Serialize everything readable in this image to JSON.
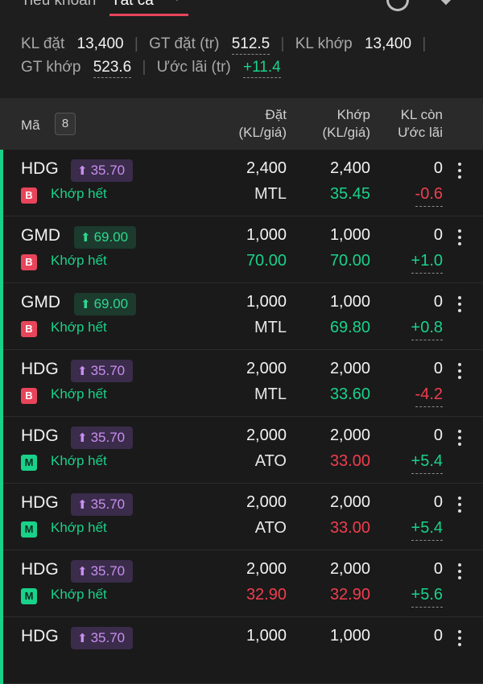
{
  "topbar": {
    "account_label": "Tiểu khoản",
    "filter_value": "Tất cả",
    "icons": [
      "refresh-icon",
      "filter-icon"
    ]
  },
  "summary": {
    "kl_dat_label": "KL đặt",
    "kl_dat": "13,400",
    "gt_dat_label": "GT đặt (tr)",
    "gt_dat": "512.5",
    "kl_khop_label": "KL khớp",
    "kl_khop": "13,400",
    "gt_khop_label": "GT khớp",
    "gt_khop": "523.6",
    "uoc_lai_label": "Ước lãi (tr)",
    "uoc_lai": "+11.4"
  },
  "header": {
    "ma": "Mã",
    "count": "8",
    "dat_l1": "Đặt",
    "dat_l2": "(KL/giá)",
    "khop_l1": "Khớp",
    "khop_l2": "(KL/giá)",
    "klcon_l1": "KL còn",
    "klcon_l2": "Ước lãi"
  },
  "rows": [
    {
      "symbol": "HDG",
      "pill": "35.70",
      "side": "B",
      "status": "Khớp hết",
      "dat_qty": "2,400",
      "dat_price": "MTL",
      "khop_qty": "2,400",
      "khop_price": "35.45",
      "remain": "0",
      "pl": "-0.6"
    },
    {
      "symbol": "GMD",
      "pill": "69.00",
      "side": "B",
      "status": "Khớp hết",
      "dat_qty": "1,000",
      "dat_price": "70.00",
      "khop_qty": "1,000",
      "khop_price": "70.00",
      "remain": "0",
      "pl": "+1.0"
    },
    {
      "symbol": "GMD",
      "pill": "69.00",
      "side": "B",
      "status": "Khớp hết",
      "dat_qty": "1,000",
      "dat_price": "MTL",
      "khop_qty": "1,000",
      "khop_price": "69.80",
      "remain": "0",
      "pl": "+0.8"
    },
    {
      "symbol": "HDG",
      "pill": "35.70",
      "side": "B",
      "status": "Khớp hết",
      "dat_qty": "2,000",
      "dat_price": "MTL",
      "khop_qty": "2,000",
      "khop_price": "33.60",
      "remain": "0",
      "pl": "-4.2"
    },
    {
      "symbol": "HDG",
      "pill": "35.70",
      "side": "M",
      "status": "Khớp hết",
      "dat_qty": "2,000",
      "dat_price": "ATO",
      "khop_qty": "2,000",
      "khop_price": "33.00",
      "remain": "0",
      "pl": "+5.4"
    },
    {
      "symbol": "HDG",
      "pill": "35.70",
      "side": "M",
      "status": "Khớp hết",
      "dat_qty": "2,000",
      "dat_price": "ATO",
      "khop_qty": "2,000",
      "khop_price": "33.00",
      "remain": "0",
      "pl": "+5.4"
    },
    {
      "symbol": "HDG",
      "pill": "35.70",
      "side": "M",
      "status": "Khớp hết",
      "dat_qty": "2,000",
      "dat_price": "32.90",
      "khop_qty": "2,000",
      "khop_price": "32.90",
      "remain": "0",
      "pl": "+5.6"
    },
    {
      "symbol": "HDG",
      "pill": "35.70",
      "side": "",
      "status": "",
      "dat_qty": "1,000",
      "dat_price": "",
      "khop_qty": "1,000",
      "khop_price": "",
      "remain": "0",
      "pl": ""
    }
  ],
  "colors": {
    "accent_green": "#19d28a",
    "accent_red": "#f03e4e",
    "purple_pill": "#c98ef0"
  }
}
